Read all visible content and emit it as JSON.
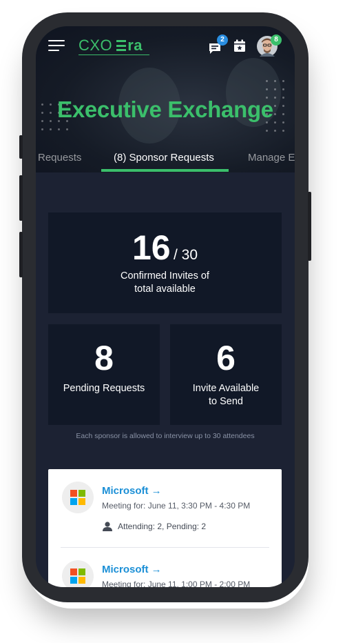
{
  "header": {
    "logo_text_left": "CXO",
    "logo_text_right": "ra",
    "messages_badge": "2",
    "profile_badge": "8",
    "hero_title": "Executive Exchange",
    "colors": {
      "accent": "#3bbf6b",
      "badge_blue": "#2a8ee0",
      "badge_green": "#3bbf6b"
    }
  },
  "tabs": [
    {
      "label": "Requests",
      "active": false
    },
    {
      "label": "(8) Sponsor Requests",
      "active": true
    },
    {
      "label": "Manage E",
      "active": false
    }
  ],
  "stats": {
    "confirmed": {
      "value": "16",
      "total": "/ 30",
      "label_line1": "Confirmed Invites of",
      "label_line2": "total available"
    },
    "pending": {
      "value": "8",
      "label": "Pending Requests"
    },
    "available": {
      "value": "6",
      "label_line1": "Invite Available",
      "label_line2": "to Send"
    },
    "note": "Each sponsor is allowed to interview up to 30 attendees"
  },
  "sponsors": [
    {
      "name": "Microsoft →",
      "meeting": "Meeting for: June 11, 3:30 PM - 4:30 PM",
      "status": "Attending: 2, Pending: 2",
      "icon": "microsoft-logo"
    },
    {
      "name": "Microsoft →",
      "meeting": "Meeting for: June 11, 1:00 PM - 2:00 PM",
      "status": "",
      "icon": "microsoft-logo"
    }
  ]
}
